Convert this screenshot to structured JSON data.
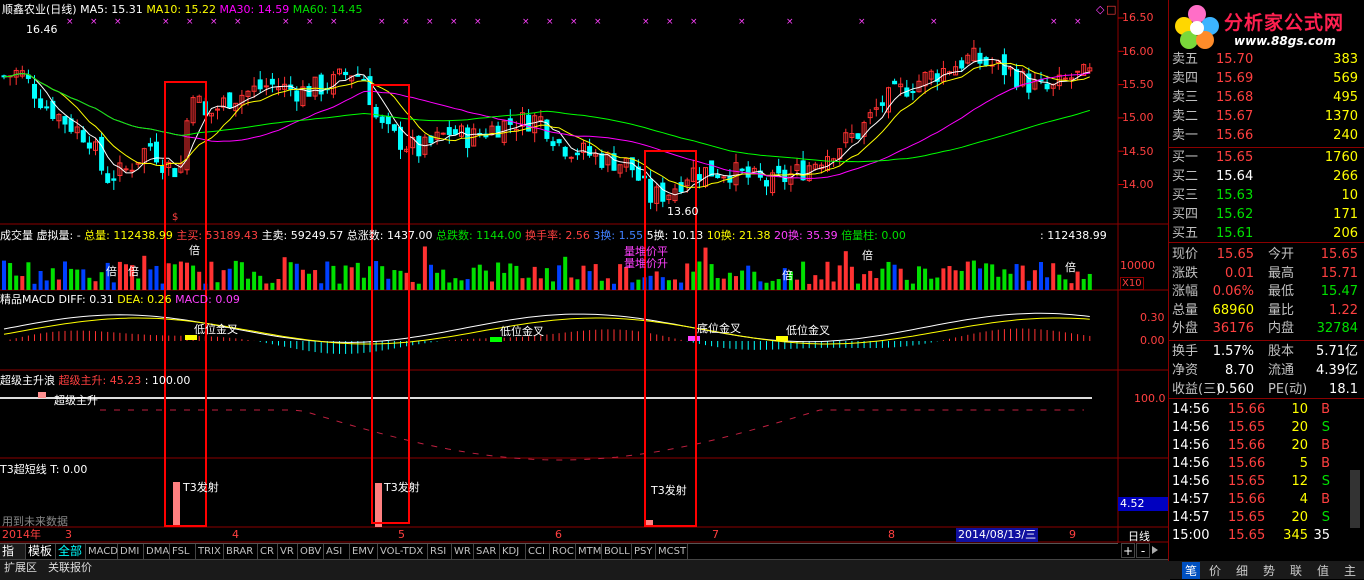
{
  "price_header": {
    "stock": "顺鑫农业(日线)",
    "ma5": "MA5: 15.31",
    "ma10": "MA10: 15.22",
    "ma30": "MA30: 14.59",
    "ma60": "MA60: 14.45"
  },
  "price_labels": {
    "high": "16.46",
    "low": "13.60"
  },
  "price_axis": [
    "16.50",
    "16.00",
    "15.50",
    "15.00",
    "14.50",
    "14.00"
  ],
  "volume_header": {
    "title": "成交量",
    "virtual": "虚拟量: -",
    "total": "总量: 112438.99",
    "active_buy": "主买: 53189.43",
    "active_sell": "主卖: 59249.57",
    "up_count": "总涨数: 1437.00",
    "down_count": "总跌数: 1144.00",
    "turnover": "换手率: 2.56",
    "h3": "3换: 1.55",
    "h5": "5换: 10.13",
    "h10": "10换: 21.38",
    "h20": "20换: 35.39",
    "double": "倍量柱: 0.00",
    "right_total": ": 112438.99"
  },
  "volume_axis": {
    "v10000": "10000",
    "x10": "X10"
  },
  "volume_annotations": [
    "倍",
    "倍",
    "倍",
    "倍",
    "倍",
    "倍"
  ],
  "volume_note": [
    "量堆价平",
    "量堆价升"
  ],
  "macd_header": {
    "title": "精品MACD",
    "diff": "DIFF: 0.31",
    "dea": "DEA: 0.26",
    "macd": "MACD: 0.09"
  },
  "macd_axis": [
    "0.30",
    "0.00"
  ],
  "macd_labels": [
    "低位金叉",
    "低位金叉",
    "底位金叉",
    "低位金叉"
  ],
  "surge_header": {
    "title": "超级主升浪",
    "sub": "超级主升: 45.23",
    "val": ": 100.00"
  },
  "surge_axis": "100.0",
  "surge_label": "超级主升",
  "t3_header": {
    "title": "T3超短线",
    "t": "T: 0.00"
  },
  "t3_labels": [
    "T3发射",
    "T3发射",
    "T3发射"
  ],
  "t3_footer": "用到未来数据",
  "t3_axis_value": "4.52",
  "date_axis": {
    "year": "2014年",
    "months": [
      "3",
      "4",
      "5",
      "6",
      "7",
      "8",
      "9"
    ],
    "cursor_date": "2014/08/13/三",
    "period": "日线"
  },
  "indicator_tabs": [
    "指标",
    "模板",
    "全部",
    "MACD",
    "DMI",
    "DMA",
    "FSL",
    "TRIX",
    "BRAR",
    "CR",
    "VR",
    "OBV",
    "ASI",
    "EMV",
    "VOL-TDX",
    "RSI",
    "WR",
    "SAR",
    "KDJ",
    "CCI",
    "ROC",
    "MTM",
    "BOLL",
    "PSY",
    "MCST"
  ],
  "bottom_tabs": [
    "扩展区",
    "关联报价"
  ],
  "zoom": [
    "+",
    "-"
  ],
  "logo": {
    "name": "分析家公式网",
    "url": "www.88gs.com"
  },
  "order_book": {
    "asks": [
      {
        "label": "卖五",
        "price": "15.70",
        "vol": "383"
      },
      {
        "label": "卖四",
        "price": "15.69",
        "vol": "569"
      },
      {
        "label": "卖三",
        "price": "15.68",
        "vol": "495"
      },
      {
        "label": "卖二",
        "price": "15.67",
        "vol": "1370"
      },
      {
        "label": "卖一",
        "price": "15.66",
        "vol": "240"
      }
    ],
    "bids": [
      {
        "label": "买一",
        "price": "15.65",
        "vol": "1760"
      },
      {
        "label": "买二",
        "price": "15.64",
        "vol": "266"
      },
      {
        "label": "买三",
        "price": "15.63",
        "vol": "10"
      },
      {
        "label": "买四",
        "price": "15.62",
        "vol": "171"
      },
      {
        "label": "买五",
        "price": "15.61",
        "vol": "206"
      }
    ]
  },
  "quote": [
    {
      "l1": "现价",
      "v1": "15.65",
      "l2": "今开",
      "v2": "15.65",
      "c1": "red",
      "c2": "red"
    },
    {
      "l1": "涨跌",
      "v1": "0.01",
      "l2": "最高",
      "v2": "15.71",
      "c1": "red",
      "c2": "red"
    },
    {
      "l1": "涨幅",
      "v1": "0.06%",
      "l2": "最低",
      "v2": "15.47",
      "c1": "red",
      "c2": "green"
    },
    {
      "l1": "总量",
      "v1": "68960",
      "l2": "量比",
      "v2": "1.22",
      "c1": "yellow",
      "c2": "red"
    },
    {
      "l1": "外盘",
      "v1": "36176",
      "l2": "内盘",
      "v2": "32784",
      "c1": "red",
      "c2": "green"
    }
  ],
  "fund": [
    {
      "l1": "换手",
      "v1": "1.57%",
      "l2": "股本",
      "v2": "5.71亿"
    },
    {
      "l1": "净资",
      "v1": "8.70",
      "l2": "流通",
      "v2": "4.39亿"
    },
    {
      "l1": "收益(三)",
      "v1": "0.560",
      "l2": "PE(动)",
      "v2": "18.1"
    }
  ],
  "ticks": [
    {
      "time": "14:56",
      "price": "15.66",
      "vol": "10",
      "dir": "B",
      "c": "red"
    },
    {
      "time": "14:56",
      "price": "15.65",
      "vol": "20",
      "dir": "S",
      "c": "green"
    },
    {
      "time": "14:56",
      "price": "15.66",
      "vol": "20",
      "dir": "B",
      "c": "red"
    },
    {
      "time": "14:56",
      "price": "15.66",
      "vol": "5",
      "dir": "B",
      "c": "red"
    },
    {
      "time": "14:56",
      "price": "15.65",
      "vol": "12",
      "dir": "S",
      "c": "green"
    },
    {
      "time": "14:57",
      "price": "15.66",
      "vol": "4",
      "dir": "B",
      "c": "red"
    },
    {
      "time": "14:57",
      "price": "15.65",
      "vol": "20",
      "dir": "S",
      "c": "green"
    },
    {
      "time": "15:00",
      "price": "15.65",
      "vol": "345",
      "dir": "35",
      "c": "white"
    }
  ],
  "side_tabs": [
    "笔",
    "价",
    "细",
    "势",
    "联",
    "值",
    "主"
  ],
  "colors": {
    "up": "#ff3232",
    "down": "#00ffff",
    "ma5": "#ffffff",
    "ma10": "#ffff00",
    "ma30": "#ff00ff",
    "ma60": "#00ff00",
    "box": "#ff0000"
  }
}
